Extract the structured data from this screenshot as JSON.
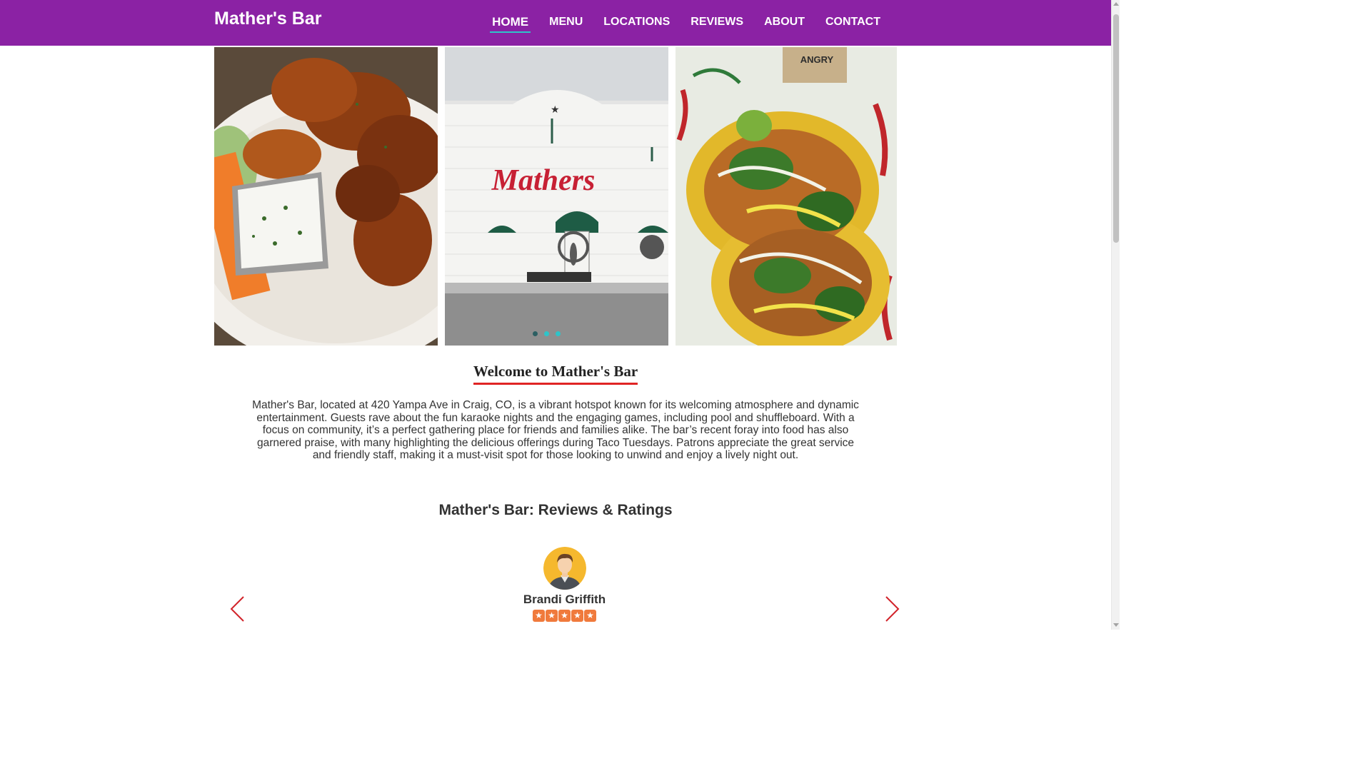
{
  "brand": "Mather's Bar",
  "nav": {
    "items": [
      {
        "label": "HOME",
        "active": true
      },
      {
        "label": "MENU"
      },
      {
        "label": "LOCATIONS"
      },
      {
        "label": "REVIEWS"
      },
      {
        "label": "ABOUT"
      },
      {
        "label": "CONTACT"
      }
    ]
  },
  "gallery": {
    "images": [
      {
        "icon": "chicken-wings-photo"
      },
      {
        "icon": "storefront-photo",
        "sign_text": "Mathers"
      },
      {
        "icon": "tacos-photo"
      }
    ],
    "dots": 3,
    "active_dot": 0
  },
  "welcome": {
    "title": "Welcome to Mather's Bar",
    "text": "Mather's Bar, located at 420 Yampa Ave in Craig, CO, is a vibrant hotspot known for its welcoming atmosphere and dynamic entertainment. Guests rave about the fun karaoke nights and the engaging games, including pool and shuffleboard. With a focus on community, it’s a perfect gathering place for friends and families alike. The bar’s recent foray into food has also garnered praise, with many highlighting the delicious offerings during Taco Tuesdays. Patrons appreciate the great service and friendly staff, making it a must-visit spot for those looking to unwind and enjoy a lively night out."
  },
  "reviews": {
    "title": "Mather's Bar: Reviews & Ratings",
    "current": {
      "name": "Brandi Griffith",
      "rating": 5,
      "rating_max": 5
    }
  },
  "colors": {
    "header_bg": "#8b22a4",
    "accent_teal": "#2ec4c9",
    "underline_red": "#e02424",
    "star_orange": "#f07a3c"
  }
}
